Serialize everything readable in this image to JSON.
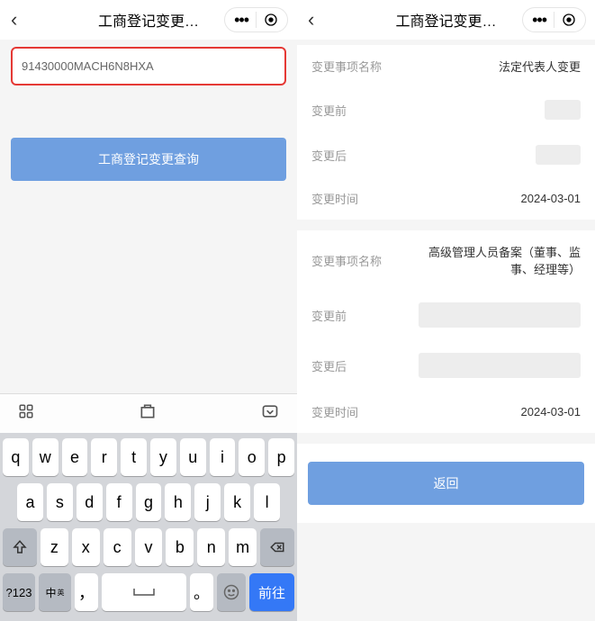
{
  "left": {
    "header": {
      "title": "工商登记变更…"
    },
    "input_value": "91430000MACH6N8HXA",
    "query_button": "工商登记变更查询",
    "keyboard": {
      "row1": [
        "q",
        "w",
        "e",
        "r",
        "t",
        "y",
        "u",
        "i",
        "o",
        "p"
      ],
      "row2": [
        "a",
        "s",
        "d",
        "f",
        "g",
        "h",
        "j",
        "k",
        "l"
      ],
      "row3": [
        "z",
        "x",
        "c",
        "v",
        "b",
        "n",
        "m"
      ],
      "num_key": "?123",
      "lang_key": "中",
      "lang_sub": "英",
      "comma": "，",
      "period": "。",
      "go_key": "前往"
    }
  },
  "right": {
    "header": {
      "title": "工商登记变更…"
    },
    "block1": {
      "name_label": "变更事项名称",
      "name_value": "法定代表人变更",
      "before_label": "变更前",
      "after_label": "变更后",
      "time_label": "变更时间",
      "time_value": "2024-03-01"
    },
    "block2": {
      "name_label": "变更事项名称",
      "name_value": "高级管理人员备案（董事、监事、经理等）",
      "before_label": "变更前",
      "after_label": "变更后",
      "time_label": "变更时间",
      "time_value": "2024-03-01"
    },
    "return_button": "返回"
  }
}
